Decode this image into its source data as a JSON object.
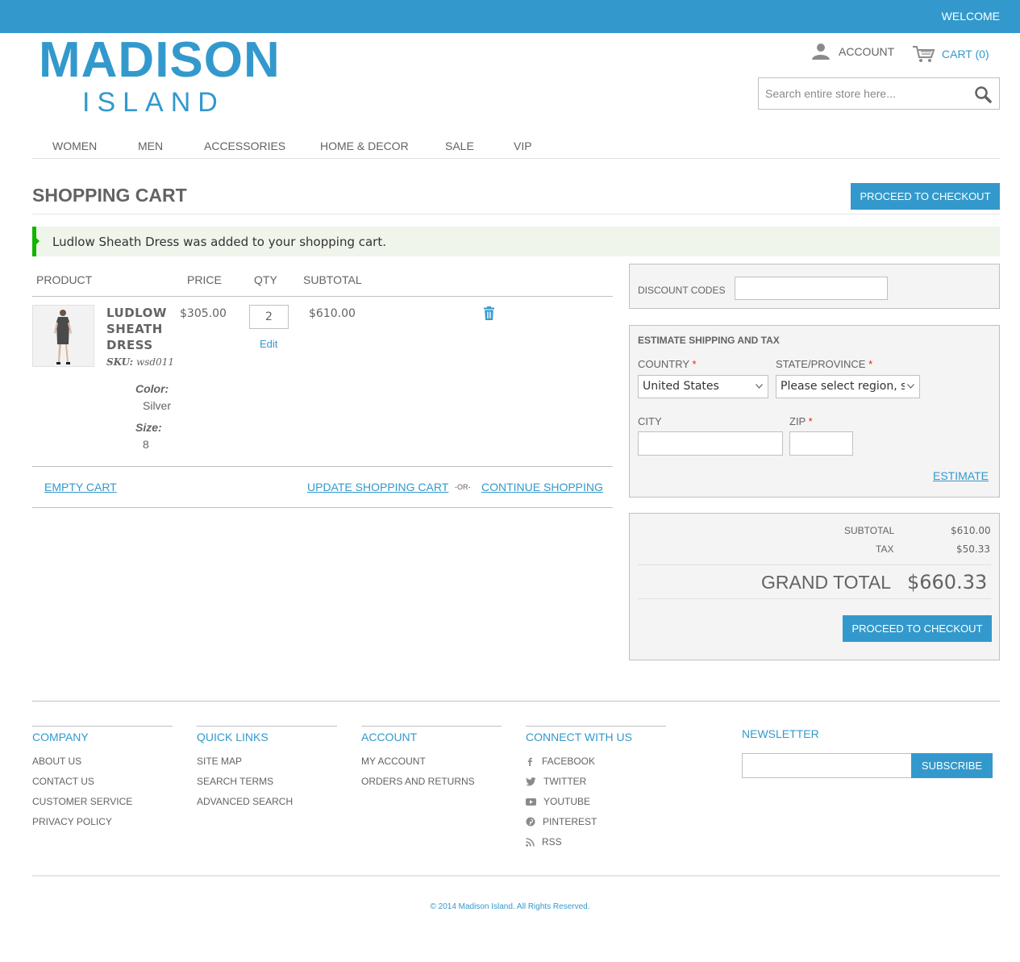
{
  "header": {
    "welcome": "WELCOME",
    "logo_line1": "MADISON",
    "logo_line2": "ISLAND",
    "account_label": "ACCOUNT",
    "cart_label": "CART (0)",
    "search_placeholder": "Search entire store here...",
    "brand_color": "#3399cc"
  },
  "nav": {
    "items": [
      "WOMEN",
      "MEN",
      "ACCESSORIES",
      "HOME & DECOR",
      "SALE",
      "VIP"
    ]
  },
  "cart": {
    "title": "SHOPPING CART",
    "checkout_label": "PROCEED TO CHECKOUT",
    "success_message": "Ludlow Sheath Dress was added to your shopping cart.",
    "columns": [
      "PRODUCT",
      "PRICE",
      "QTY",
      "SUBTOTAL"
    ],
    "item": {
      "name": "LUDLOW SHEATH DRESS",
      "sku_label": "SKU:",
      "sku": "wsd011",
      "color_label": "Color:",
      "color": "Silver",
      "size_label": "Size:",
      "size": "8",
      "price": "$305.00",
      "qty": "2",
      "edit_label": "Edit",
      "subtotal": "$610.00"
    },
    "empty_label": "EMPTY CART",
    "update_label": "UPDATE SHOPPING CART",
    "or_label": "-OR-",
    "continue_label": "CONTINUE SHOPPING"
  },
  "discount": {
    "label": "DISCOUNT CODES",
    "value": ""
  },
  "shipping": {
    "heading": "ESTIMATE SHIPPING AND TAX",
    "country_label": "COUNTRY",
    "country_value": "United States",
    "region_label": "STATE/PROVINCE",
    "region_value": "Please select region, state or province",
    "city_label": "CITY",
    "zip_label": "ZIP",
    "required_mark": "*",
    "estimate_label": "ESTIMATE"
  },
  "totals": {
    "subtotal_label": "SUBTOTAL",
    "subtotal_value": "$610.00",
    "tax_label": "TAX",
    "tax_value": "$50.33",
    "grand_label": "GRAND TOTAL",
    "grand_value": "$660.33",
    "checkout_label": "PROCEED TO CHECKOUT"
  },
  "footer": {
    "company": {
      "heading": "COMPANY",
      "items": [
        "ABOUT US",
        "CONTACT US",
        "CUSTOMER SERVICE",
        "PRIVACY POLICY"
      ]
    },
    "quick_links": {
      "heading": "QUICK LINKS",
      "items": [
        "SITE MAP",
        "SEARCH TERMS",
        "ADVANCED SEARCH"
      ]
    },
    "account": {
      "heading": "ACCOUNT",
      "items": [
        "MY ACCOUNT",
        "ORDERS AND RETURNS"
      ]
    },
    "connect": {
      "heading": "CONNECT WITH US",
      "items": [
        {
          "label": "FACEBOOK",
          "icon": "facebook-icon"
        },
        {
          "label": "TWITTER",
          "icon": "twitter-icon"
        },
        {
          "label": "YOUTUBE",
          "icon": "youtube-icon"
        },
        {
          "label": "PINTEREST",
          "icon": "pinterest-icon"
        },
        {
          "label": "RSS",
          "icon": "rss-icon"
        }
      ]
    },
    "newsletter": {
      "heading": "NEWSLETTER",
      "subscribe_label": "SUBSCRIBE"
    },
    "copyright": "© 2014 Madison Island. All Rights Reserved."
  }
}
